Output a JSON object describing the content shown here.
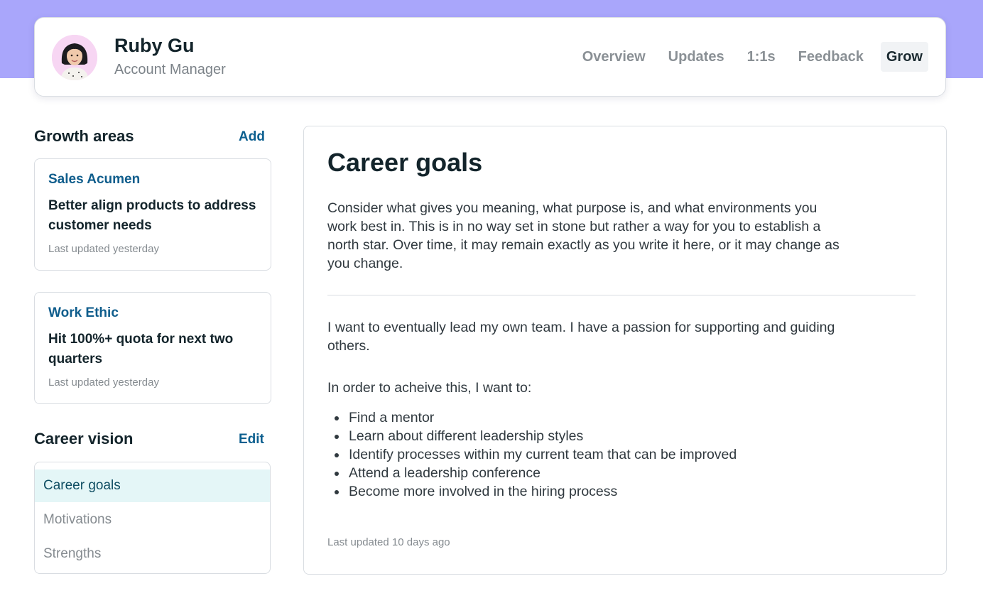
{
  "profile": {
    "name": "Ruby Gu",
    "role": "Account Manager"
  },
  "nav": {
    "tabs": [
      {
        "label": "Overview",
        "active": false
      },
      {
        "label": "Updates",
        "active": false
      },
      {
        "label": "1:1s",
        "active": false
      },
      {
        "label": "Feedback",
        "active": false
      },
      {
        "label": "Grow",
        "active": true
      }
    ]
  },
  "growth_areas": {
    "heading": "Growth areas",
    "action": "Add",
    "items": [
      {
        "category": "Sales Acumen",
        "title": "Better align products to address customer needs",
        "updated": "Last updated yesterday"
      },
      {
        "category": "Work Ethic",
        "title": "Hit 100%+ quota for next two quarters",
        "updated": "Last updated yesterday"
      }
    ]
  },
  "career_vision": {
    "heading": "Career vision",
    "action": "Edit",
    "items": [
      {
        "label": "Career goals",
        "active": true
      },
      {
        "label": "Motivations",
        "active": false
      },
      {
        "label": "Strengths",
        "active": false
      }
    ]
  },
  "main": {
    "title": "Career goals",
    "intro": "Consider what gives you meaning, what purpose is, and what environments you work best in. This is in no way set in stone but rather a way for you to establish a north star. Over time, it may remain exactly as you write it here, or it may change as you change.",
    "paragraph1": "I want to eventually lead my own team. I have a passion for supporting and guiding others.",
    "paragraph2": "In order to acheive this, I want to:",
    "bullets": [
      "Find a mentor",
      "Learn about different leadership styles",
      "Identify processes within my current team that can be improved",
      "Attend a leadership conference",
      "Become more involved in the hiring process"
    ],
    "updated": "Last updated 10 days ago"
  },
  "colors": {
    "band": "#a9a6fb",
    "link": "#0c5f8f",
    "active_row": "#e4f6f7"
  }
}
